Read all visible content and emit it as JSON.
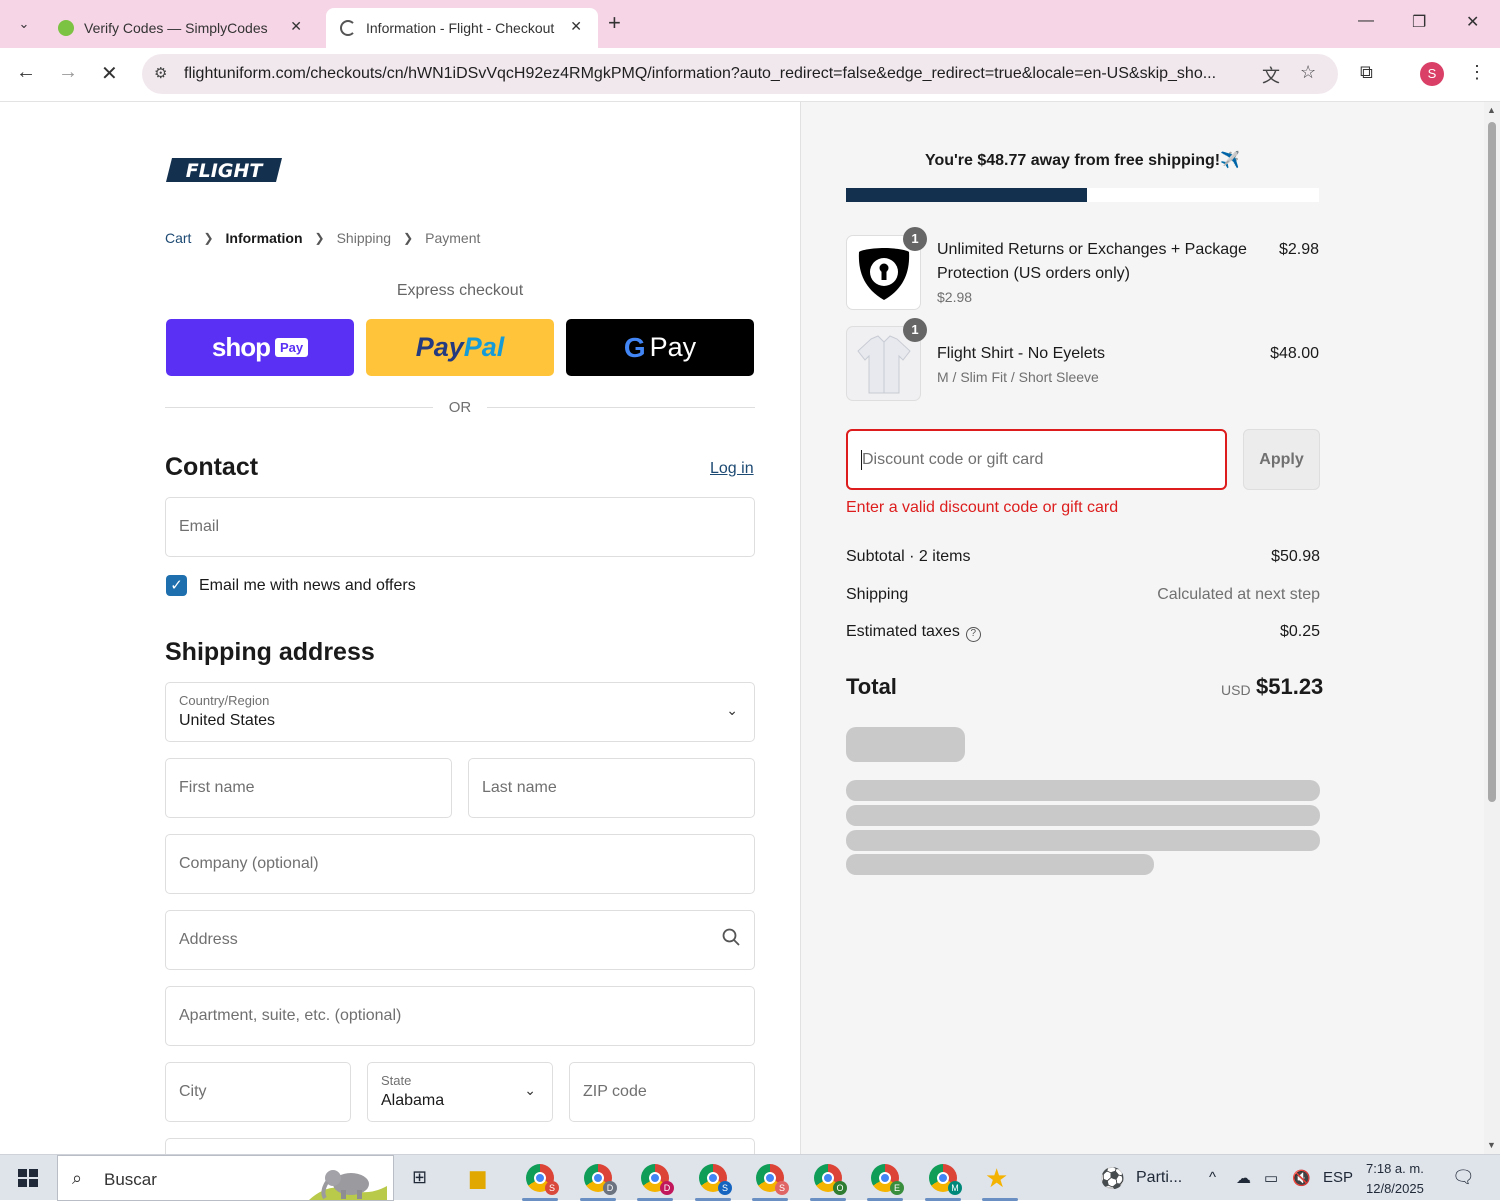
{
  "browser": {
    "tabs": [
      {
        "title": "Verify Codes — SimplyCodes",
        "active": false
      },
      {
        "title": "Information - Flight - Checkout",
        "active": true
      }
    ],
    "url": "flightuniform.com/checkouts/cn/hWN1iDSvVqcH92ez4RMgkPMQ/information?auto_redirect=false&edge_redirect=true&locale=en-US&skip_sho...",
    "profile_initial": "S"
  },
  "checkout": {
    "logo_text": "FLIGHT",
    "breadcrumb": [
      "Cart",
      "Information",
      "Shipping",
      "Payment"
    ],
    "express_label": "Express checkout",
    "shop_pay": {
      "word": "shop",
      "tag": "Pay"
    },
    "paypal": {
      "pay": "Pay",
      "pal": "Pal"
    },
    "gpay": {
      "g": "G",
      "word": "Pay"
    },
    "or_text": "OR",
    "contact": {
      "title": "Contact",
      "login": "Log in",
      "email_placeholder": "Email",
      "newsletter_label": "Email me with news and offers",
      "newsletter_checked": true
    },
    "shipping": {
      "title": "Shipping address",
      "country_label": "Country/Region",
      "country_value": "United States",
      "first_name": "First name",
      "last_name": "Last name",
      "company": "Company (optional)",
      "address": "Address",
      "apartment": "Apartment, suite, etc. (optional)",
      "city": "City",
      "state_label": "State",
      "state_value": "Alabama",
      "zip": "ZIP code"
    }
  },
  "summary": {
    "free_shipping_banner": "You're $48.77 away from free shipping!✈️",
    "free_shipping_progress": 0.51,
    "items": [
      {
        "name": "Unlimited Returns or Exchanges + Package Protection (US orders only)",
        "sub": "$2.98",
        "price": "$2.98",
        "qty": "1"
      },
      {
        "name": "Flight Shirt - No Eyelets",
        "sub": "M / Slim Fit / Short Sleeve",
        "price": "$48.00",
        "qty": "1"
      }
    ],
    "discount_placeholder": "Discount code or gift card",
    "apply_label": "Apply",
    "discount_error": "Enter a valid discount code or gift card",
    "subtotal_label": "Subtotal · 2 items",
    "subtotal_value": "$50.98",
    "shipping_label": "Shipping",
    "shipping_value": "Calculated at next step",
    "taxes_label": "Estimated taxes",
    "taxes_value": "$0.25",
    "total_label": "Total",
    "total_currency": "USD",
    "total_value": "$51.23"
  },
  "taskbar": {
    "search_text": "Buscar",
    "weather_text": "Parti...",
    "language": "ESP",
    "time": "7:18 a. m.",
    "date": "12/8/2025",
    "chrome_profiles": [
      "S",
      "D",
      "D",
      "S",
      "S",
      "O",
      "E",
      "M"
    ]
  }
}
